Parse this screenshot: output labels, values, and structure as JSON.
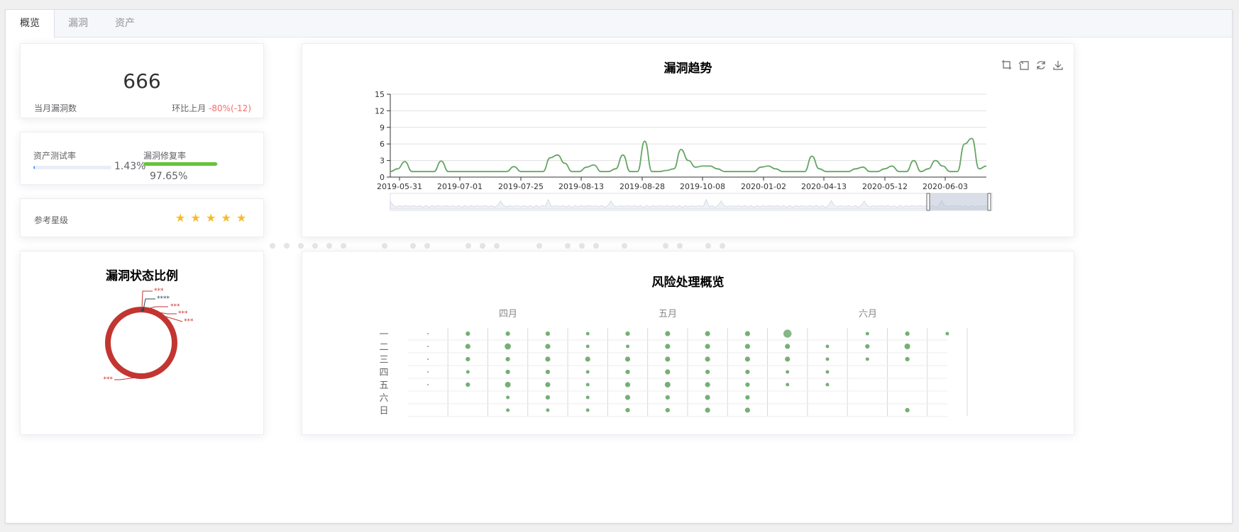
{
  "tabs": [
    {
      "label": "概览"
    },
    {
      "label": "漏洞"
    },
    {
      "label": "资产"
    }
  ],
  "stat": {
    "value": "666",
    "label": "当月漏洞数",
    "compare_label": "环比上月",
    "compare_value": "-80%(-12)"
  },
  "rates": {
    "asset_test": {
      "label": "资产测试率",
      "percent_text": "1.43%",
      "percent": 1.43
    },
    "vuln_fix": {
      "label": "漏洞修复率",
      "percent_text": "97.65%",
      "percent": 97.65
    },
    "track_color": "#ebeef5",
    "fill_color_test": "#409eff",
    "fill_color_fix": "#67c23a"
  },
  "rating": {
    "label": "参考星级",
    "stars": 5,
    "star_char": "★"
  },
  "pie": {
    "title": "漏洞状态比例",
    "labels": [
      "***",
      "****",
      "***",
      "***",
      "***",
      "***"
    ],
    "ring_color": "#c23531"
  },
  "trend": {
    "title": "漏洞趋势",
    "toolbox": [
      {
        "icon": "zoom-icon"
      },
      {
        "icon": "zoom-reset-icon"
      },
      {
        "icon": "restore-icon"
      },
      {
        "icon": "save-image-icon"
      }
    ]
  },
  "heatmap": {
    "title": "风险处理概览",
    "months": [
      "四月",
      "五月",
      "六月"
    ],
    "weekdays": [
      "一",
      "二",
      "三",
      "四",
      "五",
      "六",
      "日"
    ]
  },
  "chart_data": [
    {
      "type": "line",
      "title": "漏洞趋势",
      "x": [
        "2019-05-31",
        "2019-07-01",
        "2019-07-25",
        "2019-08-13",
        "2019-08-28",
        "2019-10-08",
        "2020-01-02",
        "2020-04-13",
        "2020-05-12",
        "2020-06-03"
      ],
      "series": [
        {
          "values": [
            1,
            1,
            1,
            1,
            1,
            1,
            1,
            1,
            1,
            1
          ]
        }
      ],
      "samples": [
        1,
        1.5,
        2.8,
        1,
        1,
        1,
        1,
        2.9,
        1,
        1,
        1,
        1,
        1,
        1,
        1,
        1,
        1,
        1.9,
        1,
        1,
        1,
        1,
        3.5,
        4,
        2.5,
        1,
        1,
        1.8,
        2.2,
        1,
        1,
        1.5,
        4,
        1,
        1,
        6.5,
        1,
        1,
        1.2,
        1.5,
        5,
        3,
        1.8,
        2,
        2,
        1.5,
        1,
        1,
        1,
        1,
        1,
        1.8,
        2,
        1.5,
        1,
        1,
        1,
        1,
        3.8,
        1.5,
        1,
        1,
        1,
        1,
        1.5,
        1.8,
        1,
        1,
        1.5,
        2,
        1,
        1,
        3,
        1,
        1.5,
        3,
        2,
        1,
        1,
        6,
        7,
        1.5,
        2
      ],
      "ylim": [
        0,
        15
      ],
      "yticks": [
        0,
        3,
        6,
        9,
        12,
        15
      ],
      "color": "#67a667",
      "grid": true
    },
    {
      "type": "scatter",
      "title": "风险处理概览",
      "categories": [
        "四月",
        "五月",
        "六月"
      ],
      "weekdays": [
        "一",
        "二",
        "三",
        "四",
        "五",
        "六",
        "日"
      ],
      "values": [
        [
          0,
          0,
          0,
          3
        ],
        [
          0,
          1,
          0,
          3
        ],
        [
          0,
          2,
          0,
          3
        ],
        [
          0,
          3,
          0,
          3
        ],
        [
          0,
          4,
          0,
          3
        ],
        [
          1,
          0,
          2,
          3
        ],
        [
          1,
          1,
          3,
          5
        ],
        [
          1,
          2,
          2,
          3
        ],
        [
          1,
          3,
          1,
          3
        ],
        [
          1,
          4,
          2,
          3
        ],
        [
          2,
          0,
          2,
          3
        ],
        [
          2,
          1,
          5,
          4
        ],
        [
          2,
          2,
          2,
          3
        ],
        [
          2,
          3,
          2,
          3
        ],
        [
          2,
          4,
          4,
          5
        ],
        [
          2,
          5,
          1,
          3
        ],
        [
          2,
          6,
          1,
          3
        ],
        [
          3,
          0,
          2,
          3
        ],
        [
          3,
          1,
          3,
          5
        ],
        [
          3,
          2,
          3,
          3
        ],
        [
          3,
          3,
          2,
          3
        ],
        [
          3,
          4,
          3,
          5
        ],
        [
          3,
          5,
          2,
          3
        ],
        [
          3,
          6,
          1,
          3
        ],
        [
          4,
          0,
          1,
          3
        ],
        [
          4,
          1,
          1,
          3
        ],
        [
          4,
          2,
          3,
          3
        ],
        [
          4,
          3,
          1,
          3
        ],
        [
          4,
          4,
          1,
          3
        ],
        [
          4,
          5,
          1,
          3
        ],
        [
          4,
          6,
          1,
          3
        ],
        [
          5,
          0,
          2,
          2
        ],
        [
          5,
          1,
          1,
          3
        ],
        [
          5,
          2,
          3,
          3
        ],
        [
          5,
          3,
          2,
          3
        ],
        [
          5,
          4,
          3,
          3
        ],
        [
          5,
          5,
          3,
          5
        ],
        [
          5,
          6,
          2,
          3
        ],
        [
          6,
          0,
          3,
          3
        ],
        [
          6,
          1,
          3,
          3
        ],
        [
          6,
          2,
          3,
          3
        ],
        [
          6,
          3,
          3,
          4
        ],
        [
          6,
          4,
          4,
          3
        ],
        [
          6,
          5,
          2,
          3
        ],
        [
          6,
          6,
          2,
          3
        ],
        [
          7,
          0,
          3,
          4
        ],
        [
          7,
          1,
          3,
          3
        ],
        [
          7,
          2,
          3,
          3
        ],
        [
          7,
          3,
          2,
          3
        ],
        [
          7,
          4,
          3,
          4
        ],
        [
          7,
          5,
          3,
          3
        ],
        [
          7,
          6,
          3,
          3
        ],
        [
          8,
          0,
          3,
          3
        ],
        [
          8,
          1,
          3,
          3
        ],
        [
          8,
          2,
          3,
          3
        ],
        [
          8,
          3,
          2,
          3
        ],
        [
          8,
          4,
          2,
          3
        ],
        [
          8,
          5,
          2,
          3
        ],
        [
          8,
          6,
          3,
          3
        ],
        [
          9,
          0,
          10,
          2
        ],
        [
          9,
          1,
          3,
          3
        ],
        [
          9,
          2,
          3,
          3
        ],
        [
          9,
          3,
          1,
          3
        ],
        [
          9,
          4,
          1,
          3
        ],
        [
          10,
          1,
          1,
          3
        ],
        [
          10,
          2,
          1,
          3
        ],
        [
          10,
          3,
          1,
          3
        ],
        [
          10,
          4,
          1,
          3
        ],
        [
          11,
          0,
          1,
          3
        ],
        [
          11,
          1,
          2,
          3
        ],
        [
          11,
          2,
          1,
          3
        ],
        [
          12,
          0,
          2,
          3
        ],
        [
          12,
          1,
          4,
          3
        ],
        [
          12,
          2,
          2,
          3
        ],
        [
          12,
          6,
          2,
          3
        ],
        [
          13,
          0,
          1,
          3
        ]
      ],
      "color": "#67a667"
    }
  ]
}
